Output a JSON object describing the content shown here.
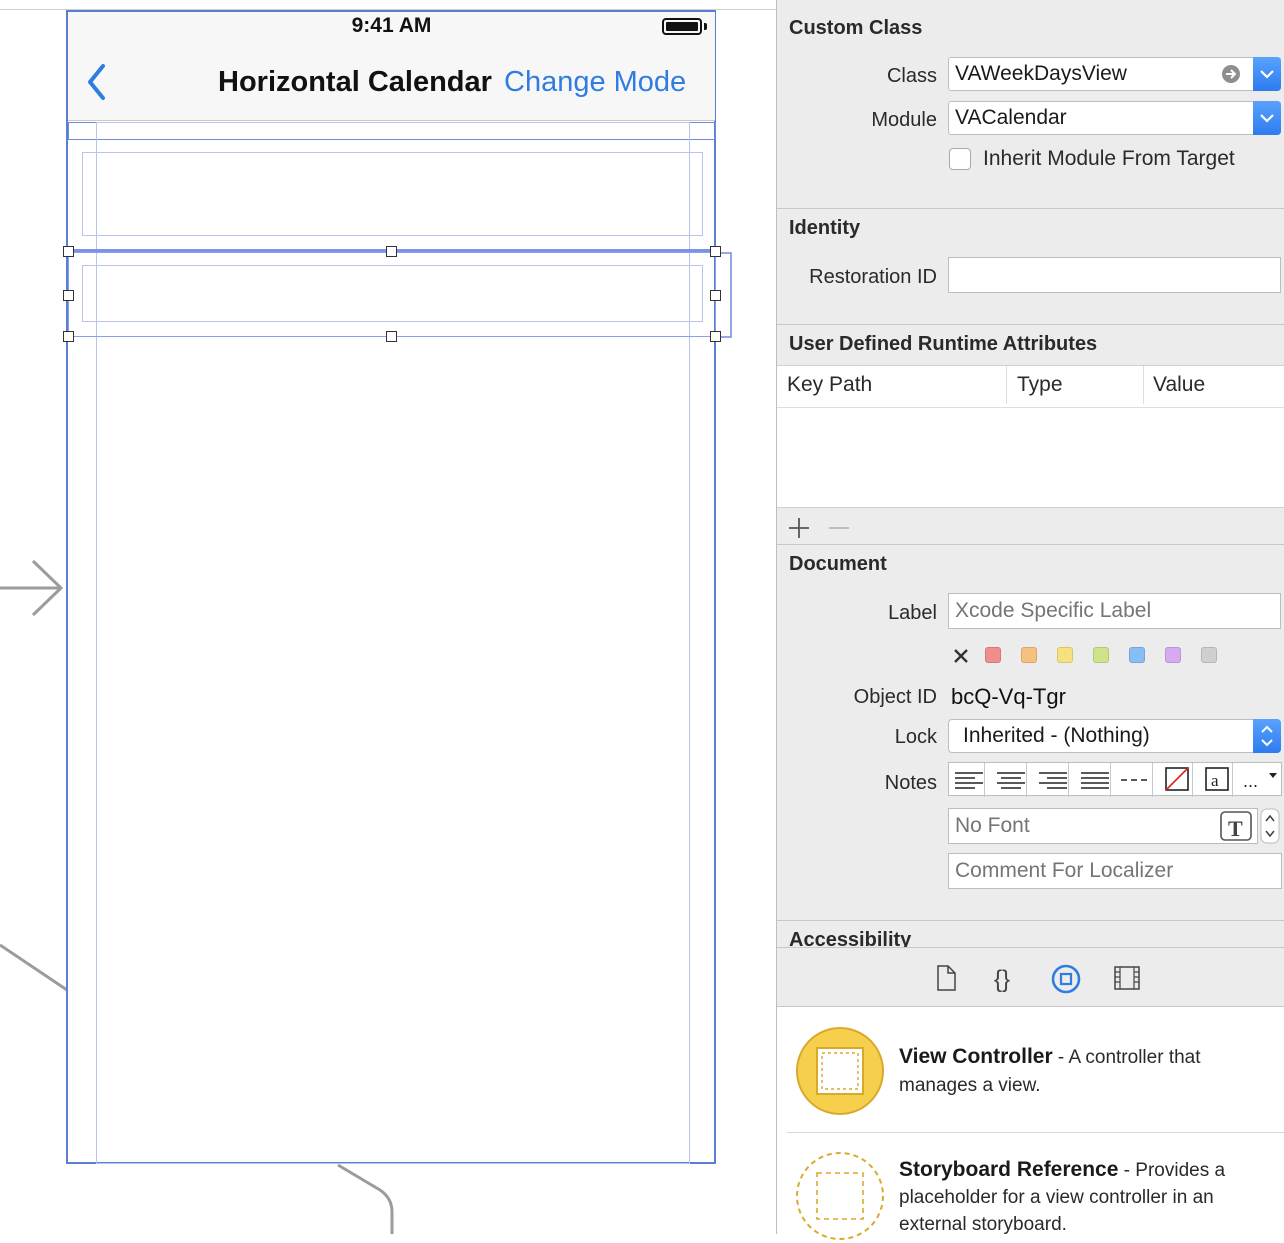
{
  "canvas": {
    "status_time": "9:41 AM",
    "nav_title": "Horizontal Calendar",
    "nav_action": "Change Mode"
  },
  "custom_class": {
    "title": "Custom Class",
    "class_label": "Class",
    "class_value": "VAWeekDaysView",
    "module_label": "Module",
    "module_value": "VACalendar",
    "inherit_label": "Inherit Module From Target"
  },
  "identity": {
    "title": "Identity",
    "restoration_label": "Restoration ID",
    "restoration_value": ""
  },
  "runtime_attributes": {
    "title": "User Defined Runtime Attributes",
    "columns": [
      "Key Path",
      "Type",
      "Value"
    ]
  },
  "document": {
    "title": "Document",
    "label_label": "Label",
    "label_placeholder": "Xcode Specific Label",
    "label_colors": [
      "#f08e8a",
      "#f6c07e",
      "#f5e27e",
      "#cfe38b",
      "#89bdf5",
      "#d6aaf0",
      "#cfcfcf"
    ],
    "object_id_label": "Object ID",
    "object_id_value": "bcQ-Vq-Tgr",
    "lock_label": "Lock",
    "lock_value": "Inherited - (Nothing)",
    "notes_label": "Notes",
    "font_placeholder": "No Font",
    "comment_placeholder": "Comment For Localizer"
  },
  "accessibility": {
    "title": "Accessibility"
  },
  "library": [
    {
      "title": "View Controller",
      "desc_line1": " - A controller that",
      "desc_line2": "manages a view."
    },
    {
      "title": "Storyboard Reference",
      "desc_line1": " - Provides a",
      "desc_line2": "placeholder for a view controller in an",
      "desc_line3": "external storyboard."
    }
  ]
}
